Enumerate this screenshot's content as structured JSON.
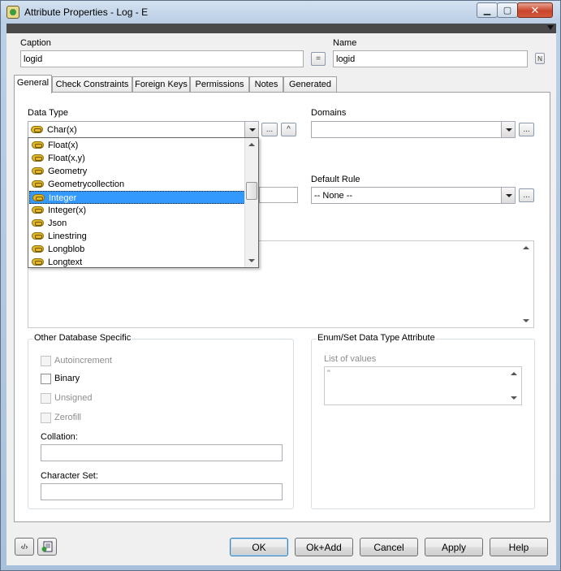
{
  "window": {
    "title": "Attribute Properties - Log - E",
    "close_glyph": "✕",
    "min_glyph": "▁",
    "max_glyph": "▢"
  },
  "header": {
    "caption_label": "Caption",
    "caption_value": "logid",
    "equals_glyph": "=",
    "name_label": "Name",
    "name_value": "logid",
    "name_button_glyph": "N"
  },
  "tabs": [
    {
      "label": "General",
      "active": true
    },
    {
      "label": "Check Constraints"
    },
    {
      "label": "Foreign Keys"
    },
    {
      "label": "Permissions"
    },
    {
      "label": "Notes"
    },
    {
      "label": "Generated"
    }
  ],
  "general": {
    "data_type_label": "Data Type",
    "data_type_value": "Char(x)",
    "data_type_options": [
      "Float(x)",
      "Float(x,y)",
      "Geometry",
      "Geometrycollection",
      "Integer",
      "Integer(x)",
      "Json",
      "Linestring",
      "Longblob",
      "Longtext"
    ],
    "data_type_selected_index": 4,
    "dots_glyph": "...",
    "up_glyph": "^",
    "domains_label": "Domains",
    "domains_value": "",
    "default_rule_label": "Default Rule",
    "default_rule_value": "-- None --"
  },
  "other_db": {
    "title": "Other Database Specific",
    "autoincrement": "Autoincrement",
    "binary": "Binary",
    "unsigned": "Unsigned",
    "zerofill": "Zerofill",
    "collation_label": "Collation:",
    "collation_value": "",
    "charset_label": "Character Set:",
    "charset_value": ""
  },
  "enum_set": {
    "title": "Enum/Set Data Type Attribute",
    "list_label": "List of values",
    "list_value": "\""
  },
  "footer": {
    "ok": "OK",
    "ok_add": "Ok+Add",
    "cancel": "Cancel",
    "apply": "Apply",
    "help": "Help",
    "code_glyph": "‹/›"
  },
  "colors": {
    "selection": "#3399ff",
    "close_button": "#c8452b"
  }
}
